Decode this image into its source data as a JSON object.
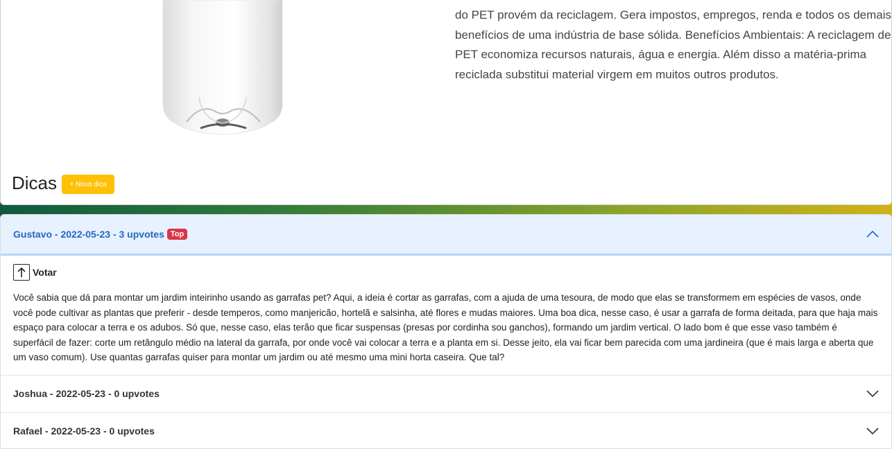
{
  "product": {
    "description": "do PET provém da reciclagem. Gera impostos, empregos, renda e todos os demais benefícios de uma indústria de base sólida. Benefícios Ambientais: A reciclagem de PET economiza recursos naturais, água e energia. Além disso a matéria-prima reciclada substitui material virgem em muitos outros produtos."
  },
  "tips_section": {
    "title": "Dicas",
    "new_button_label": "+ Nova dica"
  },
  "tips": [
    {
      "header": "Gustavo - 2022-05-23 - 3 upvotes",
      "badge": "Top",
      "vote_label": "Votar",
      "text": "Você sabia que dá para montar um jardim inteirinho usando as garrafas pet? Aqui, a ideia é cortar as garrafas, com a ajuda de uma tesoura, de modo que elas se transformem em espécies de vasos, onde você pode cultivar as plantas que preferir - desde temperos, como manjericão, hortelã e salsinha, até flores e mudas maiores. Uma boa dica, nesse caso, é usar a garrafa de forma deitada, para que haja mais espaço para colocar a terra e os adubos. Só que, nesse caso, elas terão que ficar suspensas (presas por cordinha sou ganchos), formando um jardim vertical. O lado bom é que esse vaso também é superfácil de fazer: corte um retângulo médio na lateral da garrafa, por onde você vai colocar a terra e a planta em si. Desse jeito, ela vai ficar bem parecida com uma jardineira (que é mais larga e aberta que um vaso comum). Use quantas garrafas quiser para montar um jardim ou até mesmo uma mini horta caseira. Que tal?"
    },
    {
      "header": "Joshua - 2022-05-23 - 0 upvotes"
    },
    {
      "header": "Rafael - 2022-05-23 - 0 upvotes"
    }
  ],
  "colors": {
    "accent": "#2466c4",
    "badge": "#dc3545",
    "button": "#ffc107"
  }
}
